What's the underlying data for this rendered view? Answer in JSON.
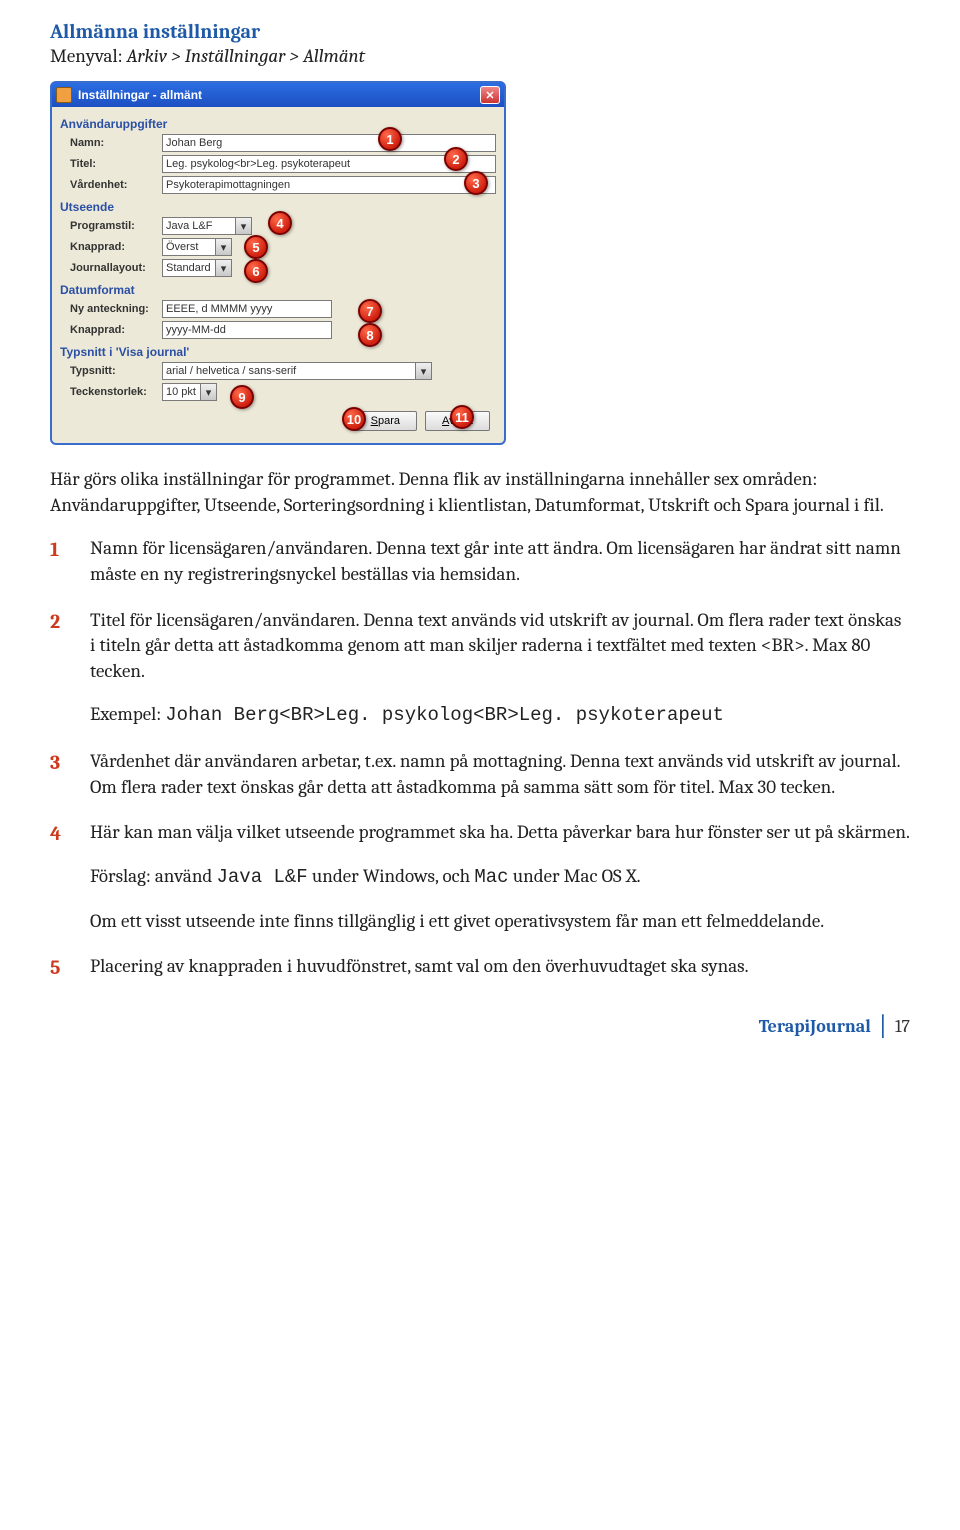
{
  "heading": "Allmänna inställningar",
  "menupath": {
    "label": "Menyval: ",
    "value": "Arkiv > Inställningar > Allmänt"
  },
  "dialog": {
    "title": "Inställningar - allmänt",
    "sections": {
      "user": {
        "title": "Användaruppgifter",
        "name_label": "Namn:",
        "name_value": "Johan Berg",
        "title_label": "Titel:",
        "title_value": "Leg. psykolog<br>Leg. psykoterapeut",
        "unit_label": "Vårdenhet:",
        "unit_value": "Psykoterapimottagningen"
      },
      "appearance": {
        "title": "Utseende",
        "style_label": "Programstil:",
        "style_value": "Java L&F",
        "toolbar_label": "Knapprad:",
        "toolbar_value": "Överst",
        "layout_label": "Journallayout:",
        "layout_value": "Standard"
      },
      "dateformat": {
        "title": "Datumformat",
        "newnote_label": "Ny anteckning:",
        "newnote_value": "EEEE, d MMMM yyyy",
        "toolbar_label": "Knapprad:",
        "toolbar_value": "yyyy-MM-dd"
      },
      "font": {
        "title": "Typsnitt i 'Visa journal'",
        "font_label": "Typsnitt:",
        "font_value": "arial / helvetica / sans-serif",
        "size_label": "Teckenstorlek:",
        "size_value": "10 pkt"
      }
    },
    "buttons": {
      "save": "Spara",
      "cancel": "Avbryt"
    },
    "callouts": [
      "1",
      "2",
      "3",
      "4",
      "5",
      "6",
      "7",
      "8",
      "9",
      "10",
      "11"
    ]
  },
  "intro": "Här görs olika inställningar för programmet. Denna flik av inställningarna innehåller sex områden: Användaruppgifter, Utseende, Sorteringsordning i klientlistan, Datumformat, Utskrift och Spara journal i fil.",
  "items": [
    {
      "num": "1",
      "paras": [
        "Namn för licensägaren/användaren. Denna text går inte att ändra. Om licensägaren har ändrat sitt namn måste en ny registreringsnyckel beställas via hemsidan."
      ]
    },
    {
      "num": "2",
      "paras": [
        "Titel för licensägaren/användaren. Denna text används vid utskrift av journal. Om flera rader text önskas i titeln går detta att åstadkomma genom att man skiljer raderna i textfältet med texten <BR>. Max 80 tecken.",
        "Exempel: {{MONO:Johan Berg<BR>Leg. psykolog<BR>Leg. psykoterapeut}}"
      ]
    },
    {
      "num": "3",
      "paras": [
        "Vårdenhet där användaren arbetar, t.ex. namn på mottagning. Denna text används vid utskrift av journal. Om flera rader text önskas går detta att åstadkomma på samma sätt som för titel. Max 30 tecken."
      ]
    },
    {
      "num": "4",
      "paras": [
        "Här kan man välja vilket utseende programmet ska ha. Detta påverkar bara hur fönster ser ut på skärmen.",
        "Förslag: använd {{MONO:Java L&F}} under Windows, och {{MONO:Mac}} under Mac OS X.",
        "Om ett visst utseende inte finns tillgänglig i ett givet operativsystem får man ett felmeddelande."
      ]
    },
    {
      "num": "5",
      "paras": [
        "Placering av knappraden i huvudfönstret, samt val om den överhuvudtaget ska synas."
      ]
    }
  ],
  "footer": {
    "brand": "TerapiJournal",
    "page": "17"
  }
}
